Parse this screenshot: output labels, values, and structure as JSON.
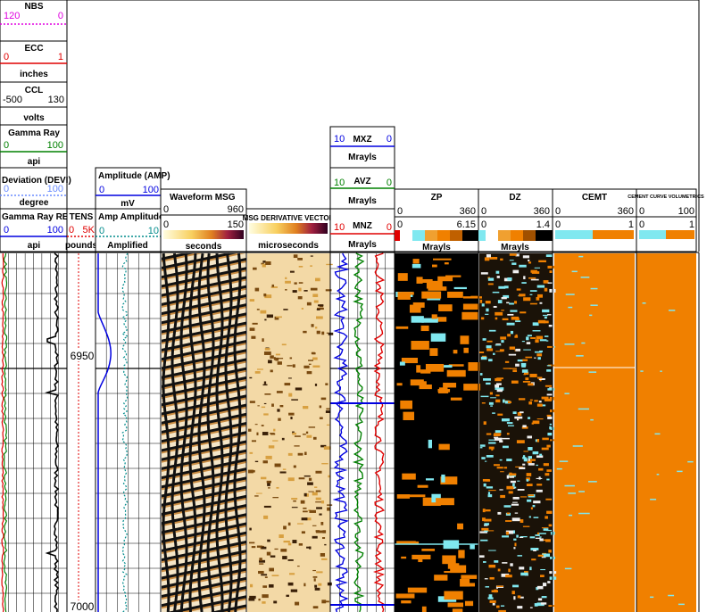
{
  "chart_data": {
    "type": "well-log",
    "depth_labels": [
      "6950",
      "7000"
    ],
    "depth_range": [
      6892,
      7002
    ],
    "tracks": [
      {
        "name": "track1",
        "curves": [
          {
            "name": "NBS",
            "min": "120",
            "max": "0",
            "unit": "",
            "color": "#e000e0",
            "dashed": true
          },
          {
            "name": "ECC",
            "min": "0",
            "max": "1",
            "unit": "inches",
            "color": "#e00000"
          },
          {
            "name": "CCL",
            "min": "-500",
            "max": "130",
            "unit": "volts",
            "color": "#000000"
          },
          {
            "name": "Gamma Ray",
            "min": "0",
            "max": "100",
            "unit": "api",
            "color": "#008000"
          },
          {
            "name": "Deviation (DEVI)",
            "min": "0",
            "max": "100",
            "unit": "degree",
            "color": "#6a8cff",
            "dashed": true
          },
          {
            "name": "Gamma Ray REF",
            "min": "0",
            "max": "100",
            "unit": "api",
            "color": "#0000e0"
          }
        ]
      },
      {
        "name": "tens",
        "curves": [
          {
            "name": "TENS",
            "min": "0",
            "max": "5K",
            "unit": "pounds",
            "color": "#e00000",
            "dashed": true
          }
        ]
      },
      {
        "name": "amplitude",
        "curves": [
          {
            "name": "Amplitude (AMP)",
            "min": "0",
            "max": "100",
            "unit": "mV",
            "color": "#0000e0"
          },
          {
            "name": "Amp Amplitude",
            "min": "0",
            "max": "10",
            "unit": "Amplified",
            "color": "#008b8b",
            "dashed": true
          }
        ]
      },
      {
        "name": "msg",
        "title": "Waveform MSG",
        "scale_top": [
          "0",
          "960"
        ],
        "scale_bottom": [
          "0",
          "150"
        ],
        "unit": "seconds"
      },
      {
        "name": "msg-derivative",
        "title": "MSG DERIVATIVE VECTOR",
        "unit": "microseconds"
      },
      {
        "name": "impedance",
        "curves": [
          {
            "name": "MXZ",
            "min": "10",
            "max": "0",
            "unit": "Mrayls",
            "color": "#0000e0"
          },
          {
            "name": "AVZ",
            "min": "10",
            "max": "0",
            "unit": "Mrayls",
            "color": "#008000"
          },
          {
            "name": "MNZ",
            "min": "10",
            "max": "0",
            "unit": "Mrayls",
            "color": "#e00000"
          }
        ]
      },
      {
        "name": "zp",
        "title": "ZP",
        "scale1": [
          "0",
          "360"
        ],
        "scale2": [
          "0",
          "6.15"
        ],
        "unit": "Mrayls"
      },
      {
        "name": "dz",
        "title": "DZ",
        "scale1": [
          "0",
          "360"
        ],
        "scale2": [
          "0",
          "1.4"
        ],
        "unit": "Mrayls"
      },
      {
        "name": "cemt",
        "title": "CEMT",
        "scale1": [
          "0",
          "360"
        ],
        "scale2": [
          "0",
          "1"
        ]
      },
      {
        "name": "ccv",
        "title": "CEMENT CURVE VOLUMETRICS",
        "scale1": [
          "0",
          "100"
        ],
        "scale2": [
          "0",
          "1"
        ]
      }
    ]
  },
  "colors": {
    "orange": "#f08000",
    "cyan": "#80e8f0",
    "black": "#000000",
    "grid": "#000000"
  }
}
